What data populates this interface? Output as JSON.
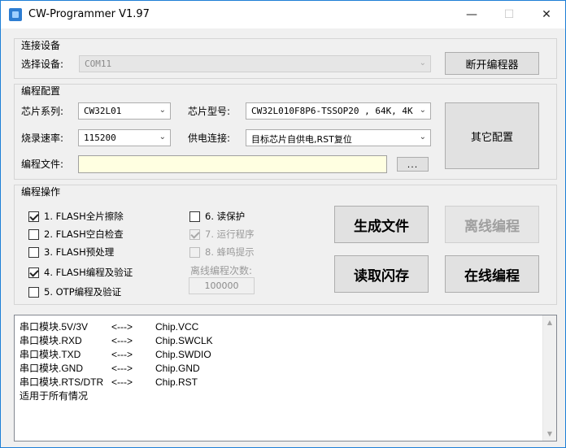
{
  "window": {
    "title": "CW-Programmer V1.97",
    "accent": "#1e7fd6"
  },
  "connect": {
    "group_title": "连接设备",
    "device_label": "选择设备:",
    "device_value": "COM11",
    "disconnect_button": "断开编程器"
  },
  "config": {
    "group_title": "编程配置",
    "chip_series_label": "芯片系列:",
    "chip_series_value": "CW32L01",
    "chip_model_label": "芯片型号:",
    "chip_model_value": "CW32L010F8P6-TSSOP20 , 64K, 4K",
    "baud_label": "烧录速率:",
    "baud_value": "115200",
    "power_label": "供电连接:",
    "power_value": "目标芯片自供电,RST复位",
    "file_label": "编程文件:",
    "file_value": "",
    "browse_button": "...",
    "other_config_button": "其它配置"
  },
  "ops": {
    "group_title": "编程操作",
    "left_options": [
      {
        "label": "1. FLASH全片擦除",
        "checked": true
      },
      {
        "label": "2. FLASH空白检查",
        "checked": false
      },
      {
        "label": "3. FLASH预处理",
        "checked": false
      },
      {
        "label": "4. FLASH编程及验证",
        "checked": true
      },
      {
        "label": "5. OTP编程及验证",
        "checked": false
      }
    ],
    "right_options": [
      {
        "label": "6. 读保护",
        "checked": false,
        "enabled": true
      },
      {
        "label": "7. 运行程序",
        "checked": true,
        "enabled": false
      },
      {
        "label": "8. 蜂鸣提示",
        "checked": false,
        "enabled": false
      }
    ],
    "offline_count_label": "离线编程次数:",
    "offline_count_value": "100000",
    "generate_button": "生成文件",
    "offline_button": "离线编程",
    "read_button": "读取闪存",
    "online_button": "在线编程"
  },
  "log": {
    "lines": [
      {
        "left": "串口模块.5V/3V",
        "arrow": "<--->",
        "right": "Chip.VCC"
      },
      {
        "left": "串口模块.RXD",
        "arrow": "<--->",
        "right": "Chip.SWCLK"
      },
      {
        "left": "串口模块.TXD",
        "arrow": "<--->",
        "right": "Chip.SWDIO"
      },
      {
        "left": "串口模块.GND",
        "arrow": "<--->",
        "right": "Chip.GND"
      },
      {
        "left": "串口模块.RTS/DTR",
        "arrow": "<--->",
        "right": "Chip.RST"
      },
      {
        "left": "适用于所有情况",
        "arrow": "",
        "right": ""
      }
    ]
  }
}
